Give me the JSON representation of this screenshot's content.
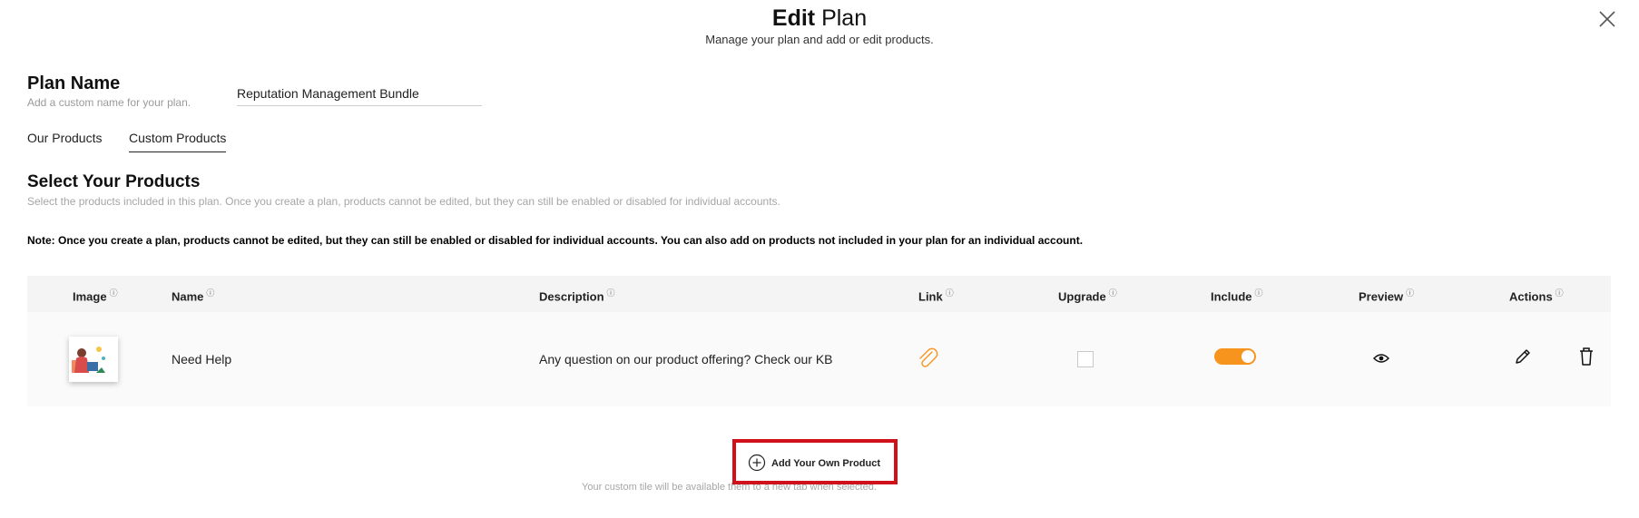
{
  "header": {
    "title_bold": "Edit",
    "title_plain": "Plan",
    "subtitle": "Manage your plan and add or edit products."
  },
  "plan": {
    "label": "Plan Name",
    "help": "Add a custom name for your plan.",
    "value": "Reputation Management Bundle"
  },
  "tabs": [
    {
      "label": "Our Products",
      "active": false
    },
    {
      "label": "Custom Products",
      "active": true
    }
  ],
  "products_section": {
    "title": "Select Your Products",
    "help": "Select the products included in this plan. Once you create a plan, products cannot be edited, but they can still be enabled or disabled for individual accounts.",
    "note": "Note: Once you create a plan, products cannot be edited, but they can still be enabled or disabled for individual accounts. You can also add on products not included in your plan for an individual account."
  },
  "table": {
    "columns": [
      "Image",
      "Name",
      "Description",
      "Link",
      "Upgrade",
      "Include",
      "Preview",
      "Actions"
    ],
    "info_glyph": "ⓘ",
    "rows": [
      {
        "name": "Need Help",
        "description": "Any question on our product offering? Check our KB",
        "link_icon": "paperclip-icon",
        "upgrade_checked": false,
        "include_enabled": true,
        "preview_icon": "eye-icon",
        "actions": [
          "pencil-icon",
          "trash-icon"
        ]
      }
    ]
  },
  "add_product": {
    "label": "Add Your Own Product",
    "help": "Your custom tile will be available                                                     them to a new tab when selected."
  },
  "colors": {
    "accent": "#f7941d",
    "highlight_border": "#d0111b",
    "table_head_bg": "#f4f4f4"
  }
}
